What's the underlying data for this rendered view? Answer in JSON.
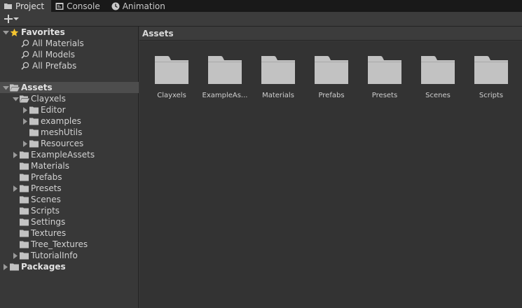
{
  "tabs": [
    {
      "label": "Project",
      "icon": "folder-icon",
      "active": true
    },
    {
      "label": "Console",
      "icon": "console-icon",
      "active": false
    },
    {
      "label": "Animation",
      "icon": "animation-icon",
      "active": false
    }
  ],
  "toolbar": {
    "create_icon": "plus-icon",
    "create_dropdown_icon": "chevron-down-icon"
  },
  "tree": {
    "favorites": {
      "label": "Favorites",
      "items": [
        "All Materials",
        "All Models",
        "All Prefabs"
      ]
    },
    "assets": {
      "label": "Assets",
      "clayxels": {
        "label": "Clayxels",
        "children": [
          {
            "label": "Editor",
            "expandable": true
          },
          {
            "label": "examples",
            "expandable": true
          },
          {
            "label": "meshUtils",
            "expandable": false
          },
          {
            "label": "Resources",
            "expandable": true
          }
        ]
      },
      "children": [
        {
          "label": "ExampleAssets",
          "expandable": true
        },
        {
          "label": "Materials",
          "expandable": false
        },
        {
          "label": "Prefabs",
          "expandable": false
        },
        {
          "label": "Presets",
          "expandable": true
        },
        {
          "label": "Scenes",
          "expandable": false
        },
        {
          "label": "Scripts",
          "expandable": false
        },
        {
          "label": "Settings",
          "expandable": false
        },
        {
          "label": "Textures",
          "expandable": false
        },
        {
          "label": "Tree_Textures",
          "expandable": false
        },
        {
          "label": "TutorialInfo",
          "expandable": true
        }
      ]
    },
    "packages": {
      "label": "Packages"
    }
  },
  "assets_panel": {
    "title": "Assets",
    "folders": [
      "Clayxels",
      "ExampleAs...",
      "Materials",
      "Prefabs",
      "Presets",
      "Scenes",
      "Scripts"
    ]
  },
  "colors": {
    "folder": "#c2c2c2",
    "star": "#f4c430",
    "selected_row": "#4d4d4d"
  }
}
